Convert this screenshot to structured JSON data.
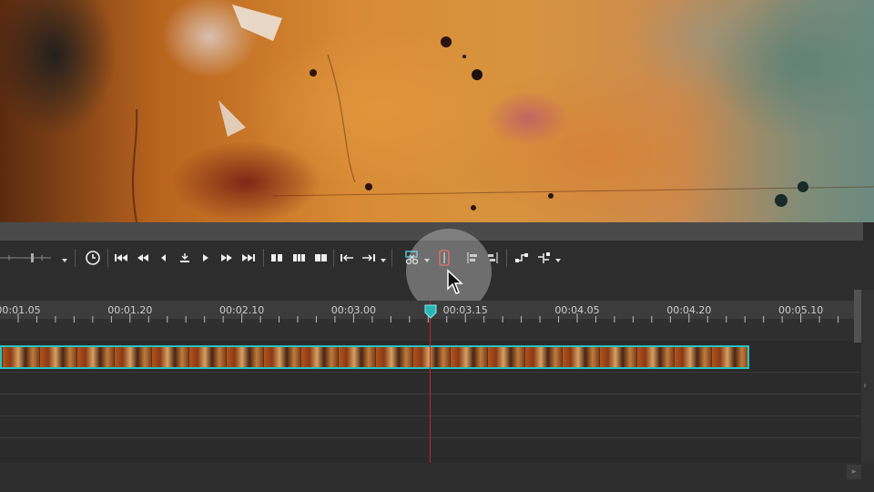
{
  "app": {
    "accent_color": "#27c3c3",
    "playhead_color": "#c0262b"
  },
  "toolbar": {
    "buttons": [
      {
        "name": "zoom-slider-icon",
        "tooltip": ""
      },
      {
        "name": "snap-clock-icon"
      },
      {
        "name": "go-to-start-icon"
      },
      {
        "name": "rewind-icon"
      },
      {
        "name": "step-back-icon"
      },
      {
        "name": "stop-icon"
      },
      {
        "name": "play-icon"
      },
      {
        "name": "fast-forward-icon"
      },
      {
        "name": "go-to-end-icon"
      },
      {
        "name": "split-icon"
      },
      {
        "name": "trim-icon"
      },
      {
        "name": "cut-icon"
      },
      {
        "name": "set-in-icon"
      },
      {
        "name": "set-out-icon"
      },
      {
        "name": "scissors-icon"
      },
      {
        "name": "marker-icon"
      },
      {
        "name": "align-left-icon"
      },
      {
        "name": "align-split-icon"
      },
      {
        "name": "group-icon"
      },
      {
        "name": "ungroup-icon"
      }
    ]
  },
  "ruler": {
    "labels": [
      "00:01.05",
      "00:01.20",
      "00:02.10",
      "00:03.00",
      "00:03.15",
      "00:04.05",
      "00:04.20",
      "00:05.10"
    ]
  },
  "timeline": {
    "playhead_time": "00:03.15",
    "clip_name": ""
  },
  "scroll": {
    "right_arrow": "›",
    "corner": "▸"
  }
}
